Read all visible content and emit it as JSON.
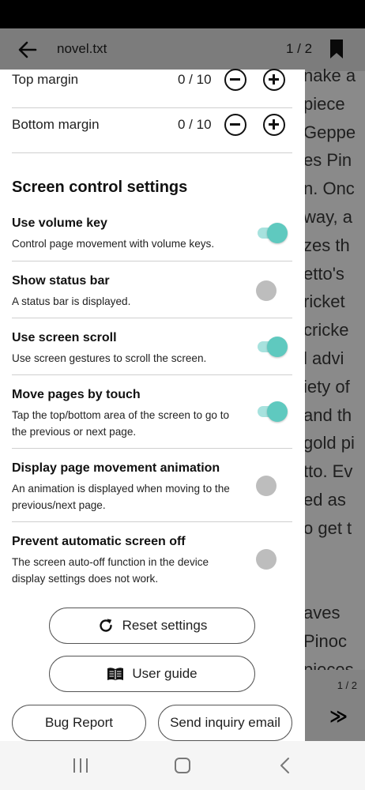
{
  "reader": {
    "title": "novel.txt",
    "page_indicator": "1 / 2",
    "text_lines": [
      "nake a",
      "piece",
      " Geppe",
      "es Pin",
      "n. Onc",
      "way, a",
      "zes th",
      "etto's",
      "ricket",
      "cricke",
      "l advi",
      "iety of",
      "and th",
      "gold pi",
      "tto. Ev",
      "ed as",
      "o get t",
      "",
      "",
      "aves",
      " Pinoc",
      "pieces"
    ],
    "footer_pages": "1 / 2",
    "footer_next": "≫"
  },
  "margins": [
    {
      "label": "Top margin",
      "value": "0 / 10"
    },
    {
      "label": "Bottom margin",
      "value": "0 / 10"
    }
  ],
  "section_title": "Screen control settings",
  "settings": [
    {
      "title": "Use volume key",
      "desc": "Control page movement with volume keys.",
      "on": true
    },
    {
      "title": "Show status bar",
      "desc": "A status bar is displayed.",
      "on": false
    },
    {
      "title": "Use screen scroll",
      "desc": "Use screen gestures to scroll the screen.",
      "on": true
    },
    {
      "title": "Move pages by touch",
      "desc": "Tap the top/bottom area of the screen to go to the previous or next page.",
      "on": true
    },
    {
      "title": "Display page movement animation",
      "desc": "An animation is displayed when moving to the previous/next page.",
      "on": false
    },
    {
      "title": "Prevent automatic screen off",
      "desc": "The screen auto-off function in the device display settings does not work.",
      "on": false
    }
  ],
  "buttons": {
    "reset": "Reset settings",
    "guide": "User guide",
    "bug": "Bug Report",
    "inquiry": "Send inquiry email"
  },
  "icons": {
    "back": "arrow-left-icon",
    "bookmark": "bookmark-icon",
    "minus": "minus-circle-icon",
    "plus": "plus-circle-icon",
    "reset": "refresh-icon",
    "guide": "book-icon"
  },
  "colors": {
    "toggle_on_knob": "#5fc9bf",
    "toggle_on_track": "#a7e2de",
    "toggle_off_knob": "#bdbdbd"
  }
}
